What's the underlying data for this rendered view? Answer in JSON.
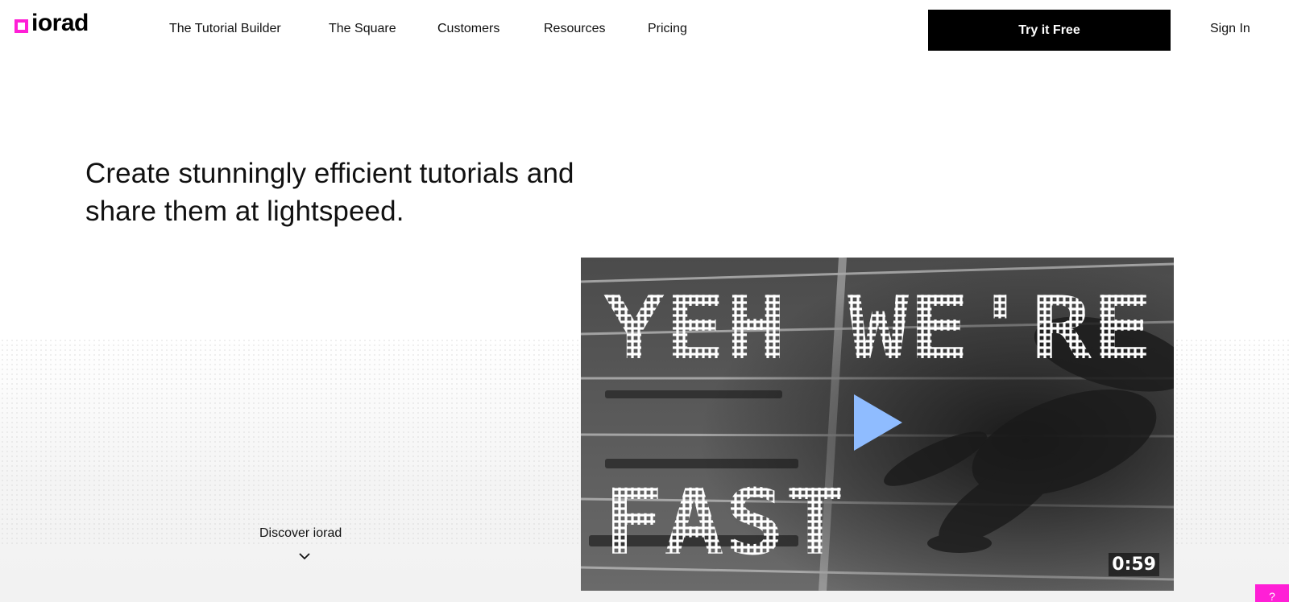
{
  "brand": {
    "logo_text": "iorad",
    "accent_color": "#ff1fd6"
  },
  "nav": {
    "items": [
      {
        "label": "The Tutorial Builder"
      },
      {
        "label": "The Square"
      },
      {
        "label": "Customers"
      },
      {
        "label": "Resources"
      },
      {
        "label": "Pricing"
      }
    ],
    "cta_label": "Try it Free",
    "signin_label": "Sign In"
  },
  "hero": {
    "title_line1": "Create stunningly efficient tutorials and",
    "title_line2": "share them at lightspeed.",
    "discover_label": "Discover iorad"
  },
  "video": {
    "overlay_line1": "YEH WE'RE",
    "overlay_line2": "FAST",
    "duration": "0:59",
    "play_icon": "play-icon",
    "play_color": "#8fbcff"
  },
  "help_tab": {
    "label": "?"
  }
}
